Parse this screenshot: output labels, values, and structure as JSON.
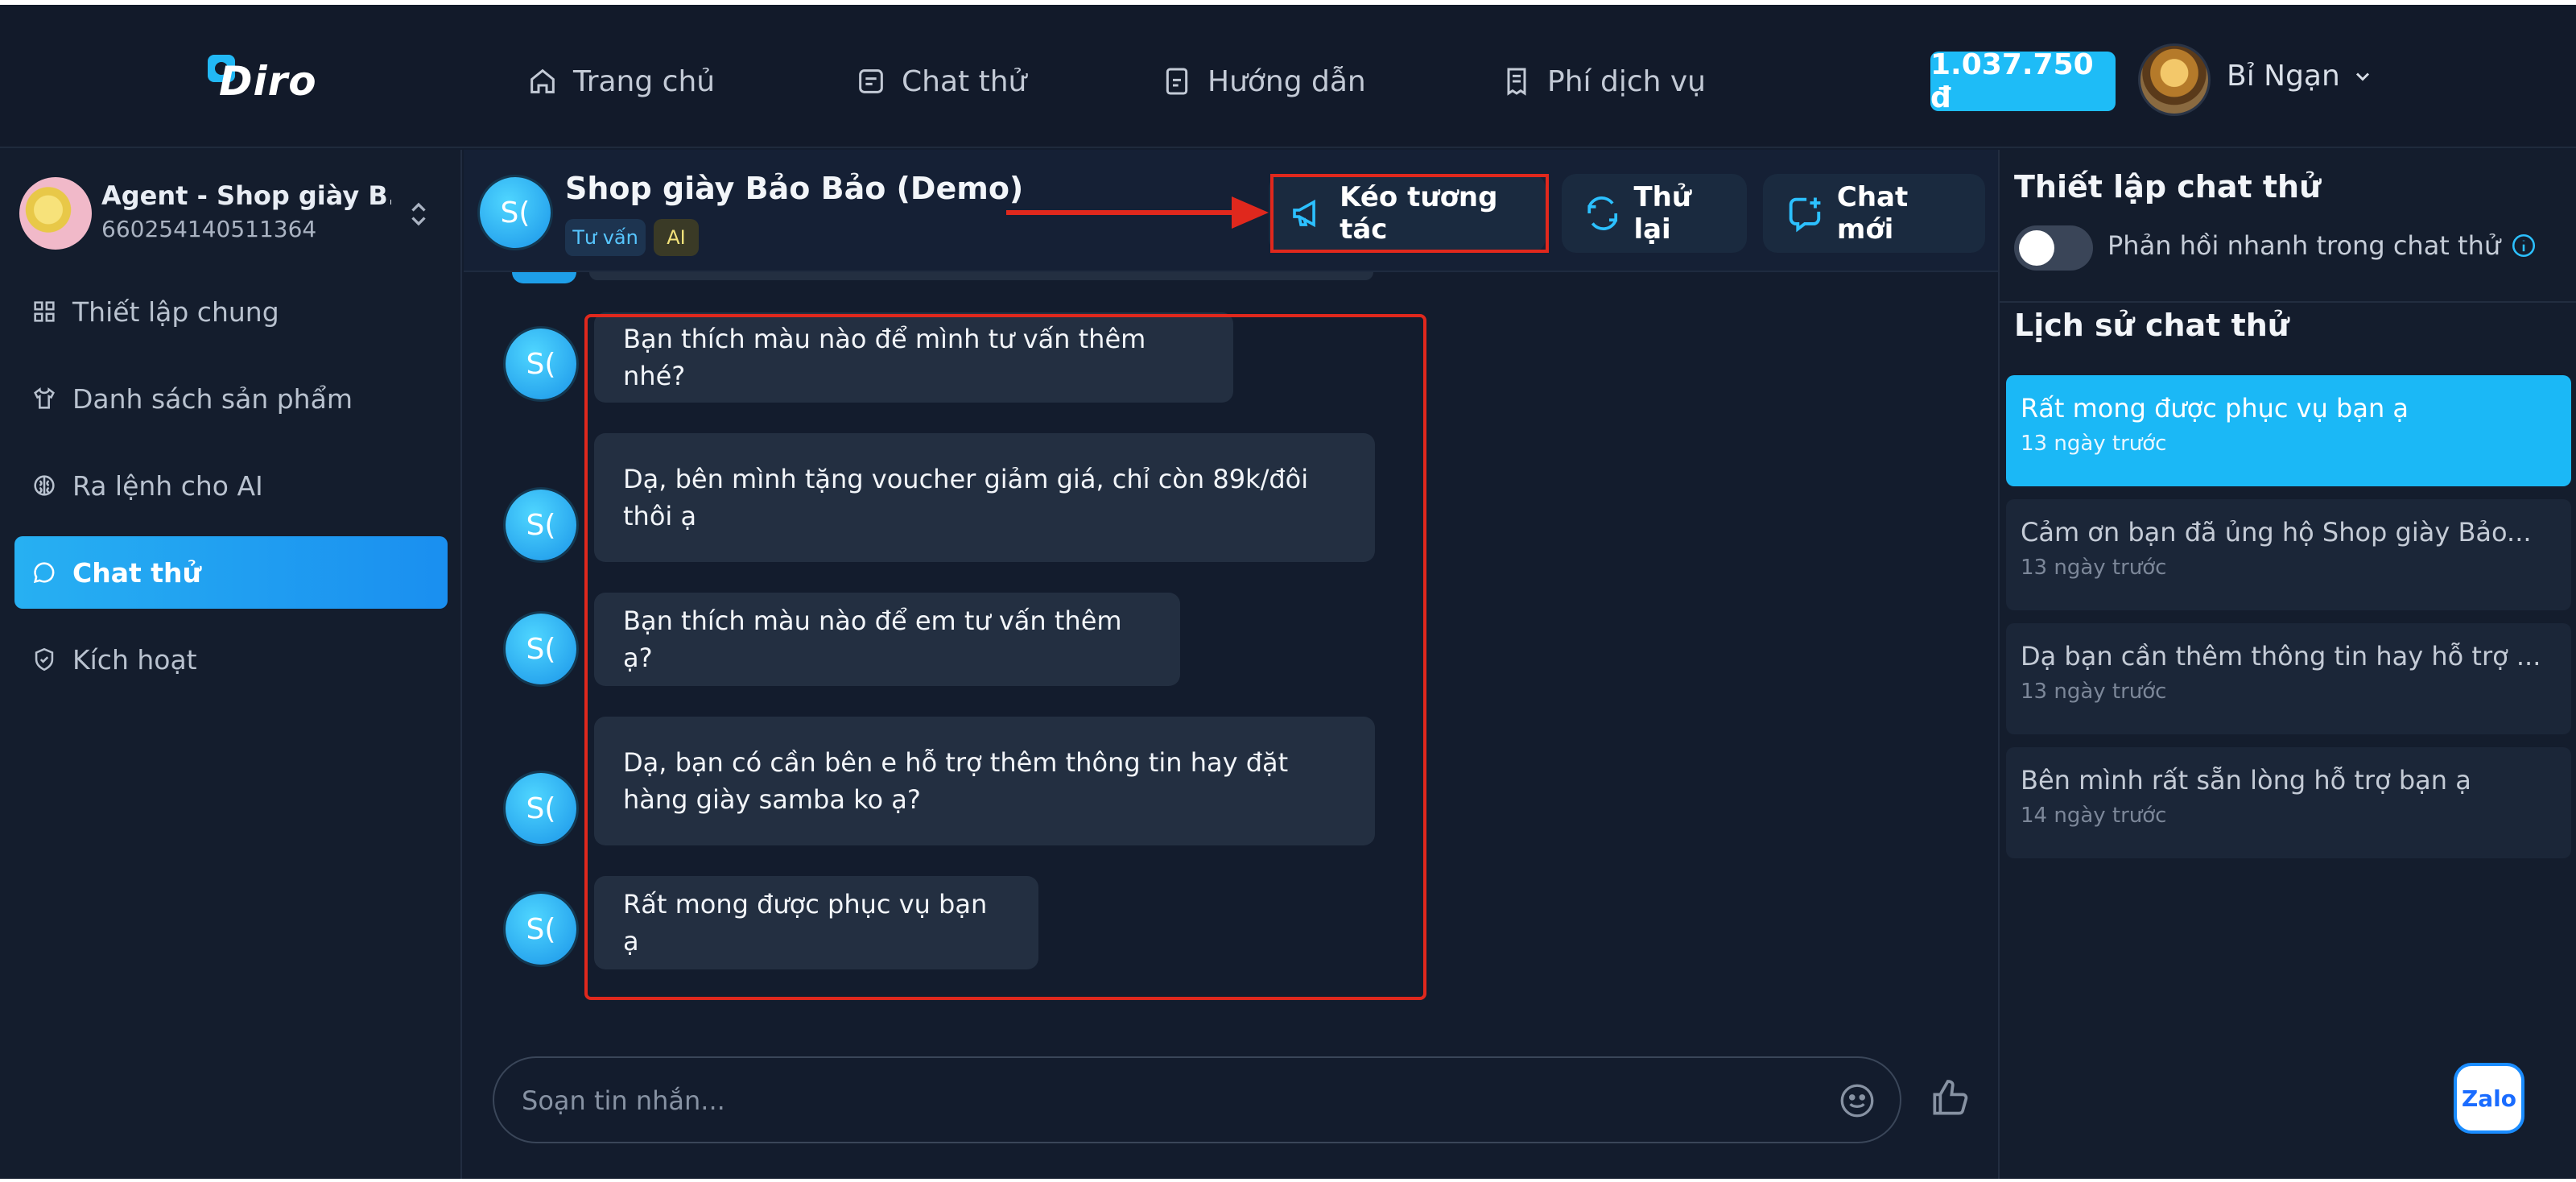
{
  "brand": {
    "logo_text": "Diro"
  },
  "nav": {
    "items": [
      {
        "label": "Trang chủ",
        "icon": "home-icon"
      },
      {
        "label": "Chat thử",
        "icon": "chat-icon"
      },
      {
        "label": "Hướng dẫn",
        "icon": "guide-icon"
      },
      {
        "label": "Phí dịch vụ",
        "icon": "receipt-icon"
      }
    ],
    "balance": "1.037.750 đ",
    "user_name": "Bỉ Ngạn"
  },
  "sidebar": {
    "agent_name": "Agent - Shop giày B...",
    "agent_id": "660254140511364",
    "items": [
      {
        "label": "Thiết lập chung",
        "icon": "grid-icon"
      },
      {
        "label": "Danh sách sản phẩm",
        "icon": "shirt-icon"
      },
      {
        "label": "Ra lệnh cho AI",
        "icon": "brain-icon"
      },
      {
        "label": "Chat thử",
        "icon": "chat-icon",
        "active": true
      },
      {
        "label": "Kích hoạt",
        "icon": "shield-icon"
      }
    ]
  },
  "chat": {
    "title": "Shop giày Bảo Bảo (Demo)",
    "avatar_text": "S(",
    "tags": [
      "Tư vấn",
      "AI"
    ],
    "buttons": {
      "keo": "Kéo tương tác",
      "retry": "Thử lại",
      "new_chat": "Chat mới"
    },
    "messages": [
      {
        "text": "Bạn thích màu nào để mình tư vấn thêm nhé?"
      },
      {
        "text": "Dạ, bên mình tặng voucher giảm giá, chỉ còn 89k/đôi thôi ạ"
      },
      {
        "text": "Bạn thích màu nào để em tư vấn thêm ạ?"
      },
      {
        "text": "Dạ, bạn có cần bên e hỗ trợ thêm thông tin hay đặt hàng giày samba ko ạ?"
      },
      {
        "text": "Rất mong được phục vụ bạn ạ"
      }
    ],
    "input_placeholder": "Soạn tin nhắn..."
  },
  "right_panel": {
    "settings_title": "Thiết lập chat thử",
    "quick_reply_label": "Phản hồi nhanh trong chat thử",
    "history_title": "Lịch sử chat thử",
    "history": [
      {
        "title": "Rất mong được phục vụ bạn ạ",
        "time": "13 ngày trước",
        "active": true
      },
      {
        "title": "Cảm ơn bạn đã ủng hộ Shop giày Bảo...",
        "time": "13 ngày trước"
      },
      {
        "title": "Dạ bạn cần thêm thông tin hay hỗ trợ ...",
        "time": "13 ngày trước"
      },
      {
        "title": "Bên mình rất sẵn lòng hỗ trợ bạn ạ",
        "time": "14 ngày trước"
      }
    ]
  },
  "widgets": {
    "zalo_label": "Zalo"
  },
  "colors": {
    "accent": "#1ebcf7",
    "annotation_red": "#e0281d",
    "background": "#131c2d"
  }
}
